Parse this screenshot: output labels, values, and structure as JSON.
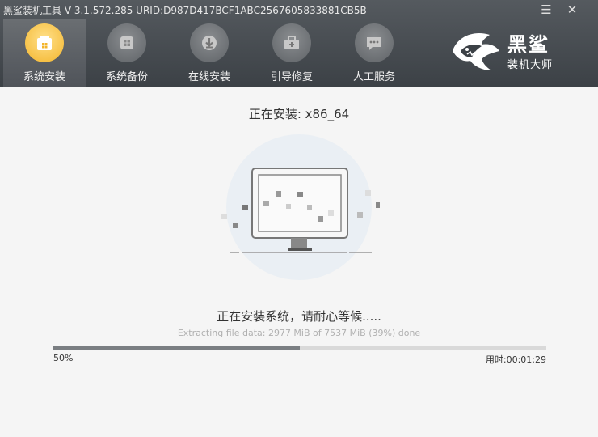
{
  "window": {
    "title": "黑鲨装机工具 V 3.1.572.285 URID:D987D417BCF1ABC2567605833881CB5B",
    "menu_icon": "menu-icon",
    "close_icon": "close-icon"
  },
  "nav": {
    "items": [
      {
        "label": "系统安装",
        "icon": "system-install-icon",
        "active": true
      },
      {
        "label": "系统备份",
        "icon": "system-backup-icon",
        "active": false
      },
      {
        "label": "在线安装",
        "icon": "online-install-icon",
        "active": false
      },
      {
        "label": "引导修复",
        "icon": "boot-repair-icon",
        "active": false
      },
      {
        "label": "人工服务",
        "icon": "chat-service-icon",
        "active": false
      }
    ]
  },
  "logo": {
    "line1": "黑鲨",
    "line2": "装机大师",
    "icon": "shark-logo-icon"
  },
  "install": {
    "title": "正在安装: x86_64",
    "status": "正在安装系统，请耐心等候.....",
    "detail": "Extracting file data: 2977 MiB of 7537 MiB (39%) done",
    "progress_value": 0.5,
    "percent_label": "50%",
    "elapsed_label": "用时:00:01:29",
    "illustration": "monitor-installing-illustration"
  },
  "colors": {
    "header": "#4a4f54",
    "active_icon": "#f3b52c",
    "progress_fill": "#7a7e82",
    "progress_track": "#d9d9d9"
  }
}
